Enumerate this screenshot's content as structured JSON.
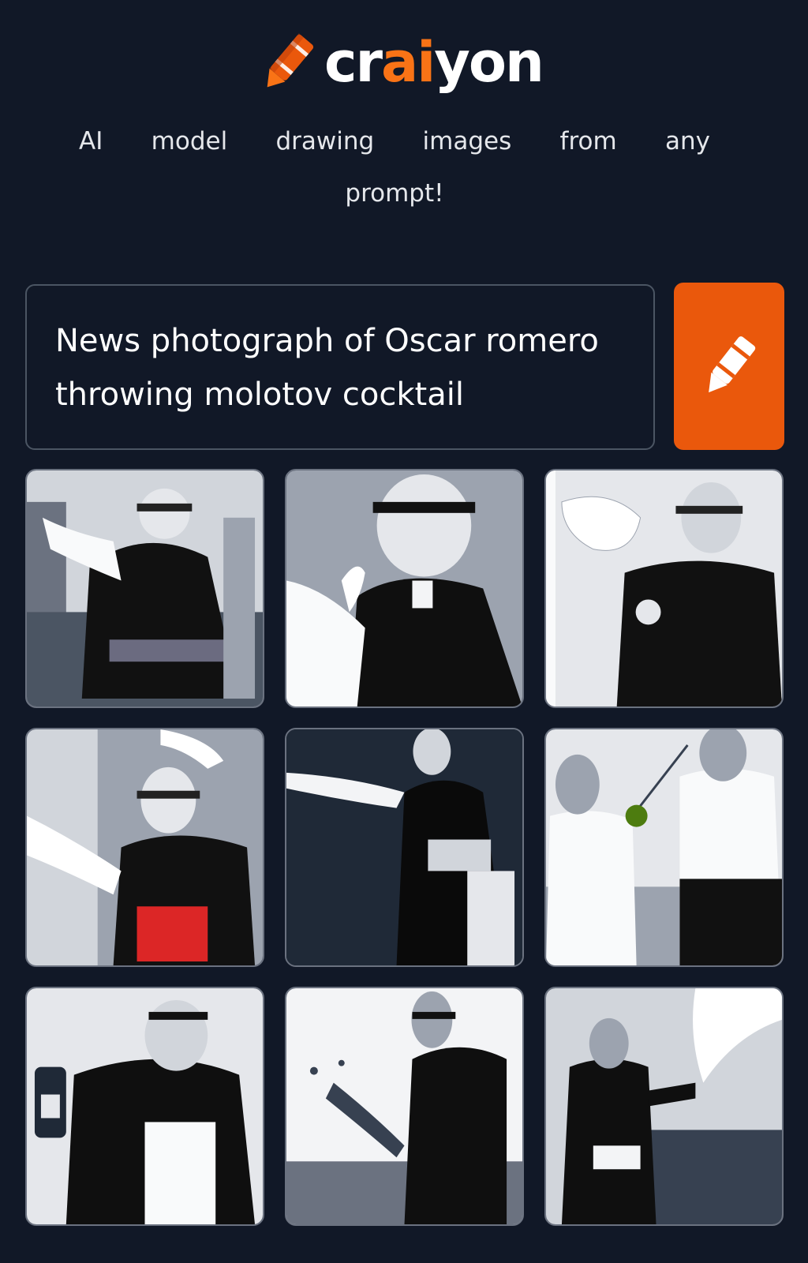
{
  "brand": {
    "name_prefix": "cr",
    "name_accent": "ai",
    "name_suffix": "yon",
    "accent_color": "#f97316",
    "logo_icon": "crayon-icon"
  },
  "tagline": "AI model drawing images from any prompt!",
  "prompt": {
    "value": "News photograph of Oscar romero throwing molotov cocktail"
  },
  "draw_button": {
    "icon": "crayon-icon",
    "color": "#ea580c"
  },
  "results": [
    {
      "id": 1,
      "variant": "gray"
    },
    {
      "id": 2,
      "variant": "gray"
    },
    {
      "id": 3,
      "variant": "gray"
    },
    {
      "id": 4,
      "variant": "red-sash"
    },
    {
      "id": 5,
      "variant": "gray"
    },
    {
      "id": 6,
      "variant": "white-robes"
    },
    {
      "id": 7,
      "variant": "gray"
    },
    {
      "id": 8,
      "variant": "gray"
    },
    {
      "id": 9,
      "variant": "gray"
    }
  ],
  "colors": {
    "background": "#111827",
    "border": "#4b5563",
    "button": "#ea580c"
  }
}
